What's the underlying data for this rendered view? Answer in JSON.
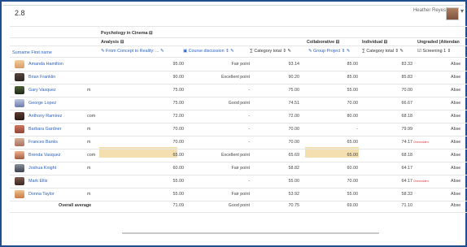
{
  "app": {
    "version": "2.8",
    "user_name": "Heather Reyes"
  },
  "header": {
    "course": "Psychology in Cinema",
    "groups": {
      "analysis": "Analysis",
      "collaborative": "Collaborative",
      "individual": "Individual",
      "ungraded": "Ungraded (Attendan"
    },
    "surname_first_name": "Surname First name",
    "columns": [
      "From Concept to Reality: ...",
      "Course discussion",
      "Category total",
      "Group Project",
      "Category total",
      "Screening 1"
    ]
  },
  "rows": [
    {
      "name": "Amanda Hamilton",
      "email": "",
      "c1": "95.00",
      "c2": "Fair point",
      "c3": "93.14",
      "c4": "85.00",
      "c5": "83.33",
      "c6": "Abse"
    },
    {
      "name": "Brian Franklin",
      "email": "",
      "c1": "90.00",
      "c2": "Excellent point",
      "c3": "90.20",
      "c4": "85.00",
      "c5": "85.83",
      "c6": "Abse"
    },
    {
      "name": "Gary Vasquez",
      "email": "m",
      "c1": "75.00",
      "c2": "-",
      "c3": "75.00",
      "c4": "55.00",
      "c5": "70.00",
      "c6": "Abse"
    },
    {
      "name": "George Lopez",
      "email": "",
      "c1": "75.00",
      "c2": "Good point",
      "c3": "74.51",
      "c4": "70.00",
      "c5": "66.67",
      "c6": "Abse"
    },
    {
      "name": "Anthony Ramirez",
      "email": "com",
      "c1": "72.00",
      "c2": "-",
      "c3": "72.00",
      "c4": "80.00",
      "c5": "68.18",
      "c6": "Abse"
    },
    {
      "name": "Barbara Gardner",
      "email": "m",
      "c1": "70.00",
      "c2": "-",
      "c3": "70.00",
      "c4": "-",
      "c5": "79.99",
      "c6": "Abse"
    },
    {
      "name": "Frances Banks",
      "email": "m",
      "c1": "70.00",
      "c2": "-",
      "c3": "70.00",
      "c4": "65.00",
      "c5": "74.17",
      "c6": "Abse",
      "overridden": "Overridden"
    },
    {
      "name": "Brenda Vasquez",
      "email": "com",
      "c1": "65.00",
      "c2": "Excellent point",
      "c3": "65.69",
      "c4": "65.00",
      "c5": "68.18",
      "c6": "Abse"
    },
    {
      "name": "Joshua Knight",
      "email": "m",
      "c1": "60.00",
      "c2": "Fair point",
      "c3": "58.82",
      "c4": "60.00",
      "c5": "64.17",
      "c6": "Abse"
    },
    {
      "name": "Mark Ellis",
      "email": "",
      "c1": "55.00",
      "c2": "-",
      "c3": "55.00",
      "c4": "70.00",
      "c5": "64.17",
      "c6": "Abse",
      "overridden": "Overridden"
    },
    {
      "name": "Donna Taylor",
      "email": "m",
      "c1": "55.00",
      "c2": "Fair point",
      "c3": "53.92",
      "c4": "55.00",
      "c5": "58.33",
      "c6": "Abse"
    }
  ],
  "overall": {
    "label": "Overall average",
    "c1": "71.09",
    "c2": "Good point",
    "c3": "70.75",
    "c4": "69.00",
    "c5": "71.10",
    "c6": "Abse"
  }
}
